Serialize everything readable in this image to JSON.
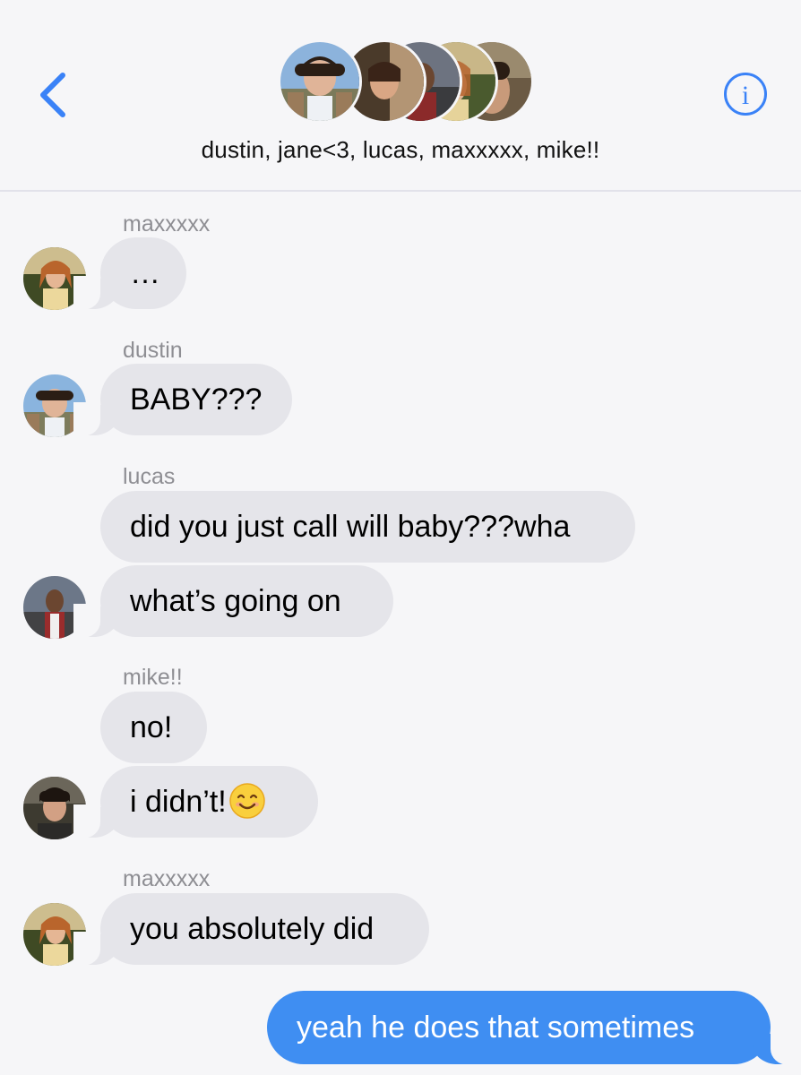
{
  "header": {
    "group_title": "dustin, jane<3, lucas, maxxxxx, mike!!",
    "back_icon": "chevron-left-icon",
    "info_icon": "info-circle-icon",
    "accent_color": "#3a82f7"
  },
  "messages": [
    {
      "sender": "maxxxxx",
      "text": "…"
    },
    {
      "sender": "dustin",
      "text": "BABY???"
    },
    {
      "sender": "lucas",
      "text": "did you just call will baby???wha"
    },
    {
      "sender": "lucas",
      "text": "what’s going on"
    },
    {
      "sender": "mike!!",
      "text": "no!"
    },
    {
      "sender": "mike!!",
      "text": "i didn’t!",
      "emoji": "smiling-face-emoji"
    },
    {
      "sender": "maxxxxx",
      "text": "you absolutely did"
    },
    {
      "sender": "me",
      "text": "yeah he does that sometimes"
    }
  ],
  "colors": {
    "incoming_bubble": "#e5e5ea",
    "outgoing_bubble": "#3f8ef2",
    "sender_label": "#8e8e93",
    "background": "#f6f6f8"
  }
}
